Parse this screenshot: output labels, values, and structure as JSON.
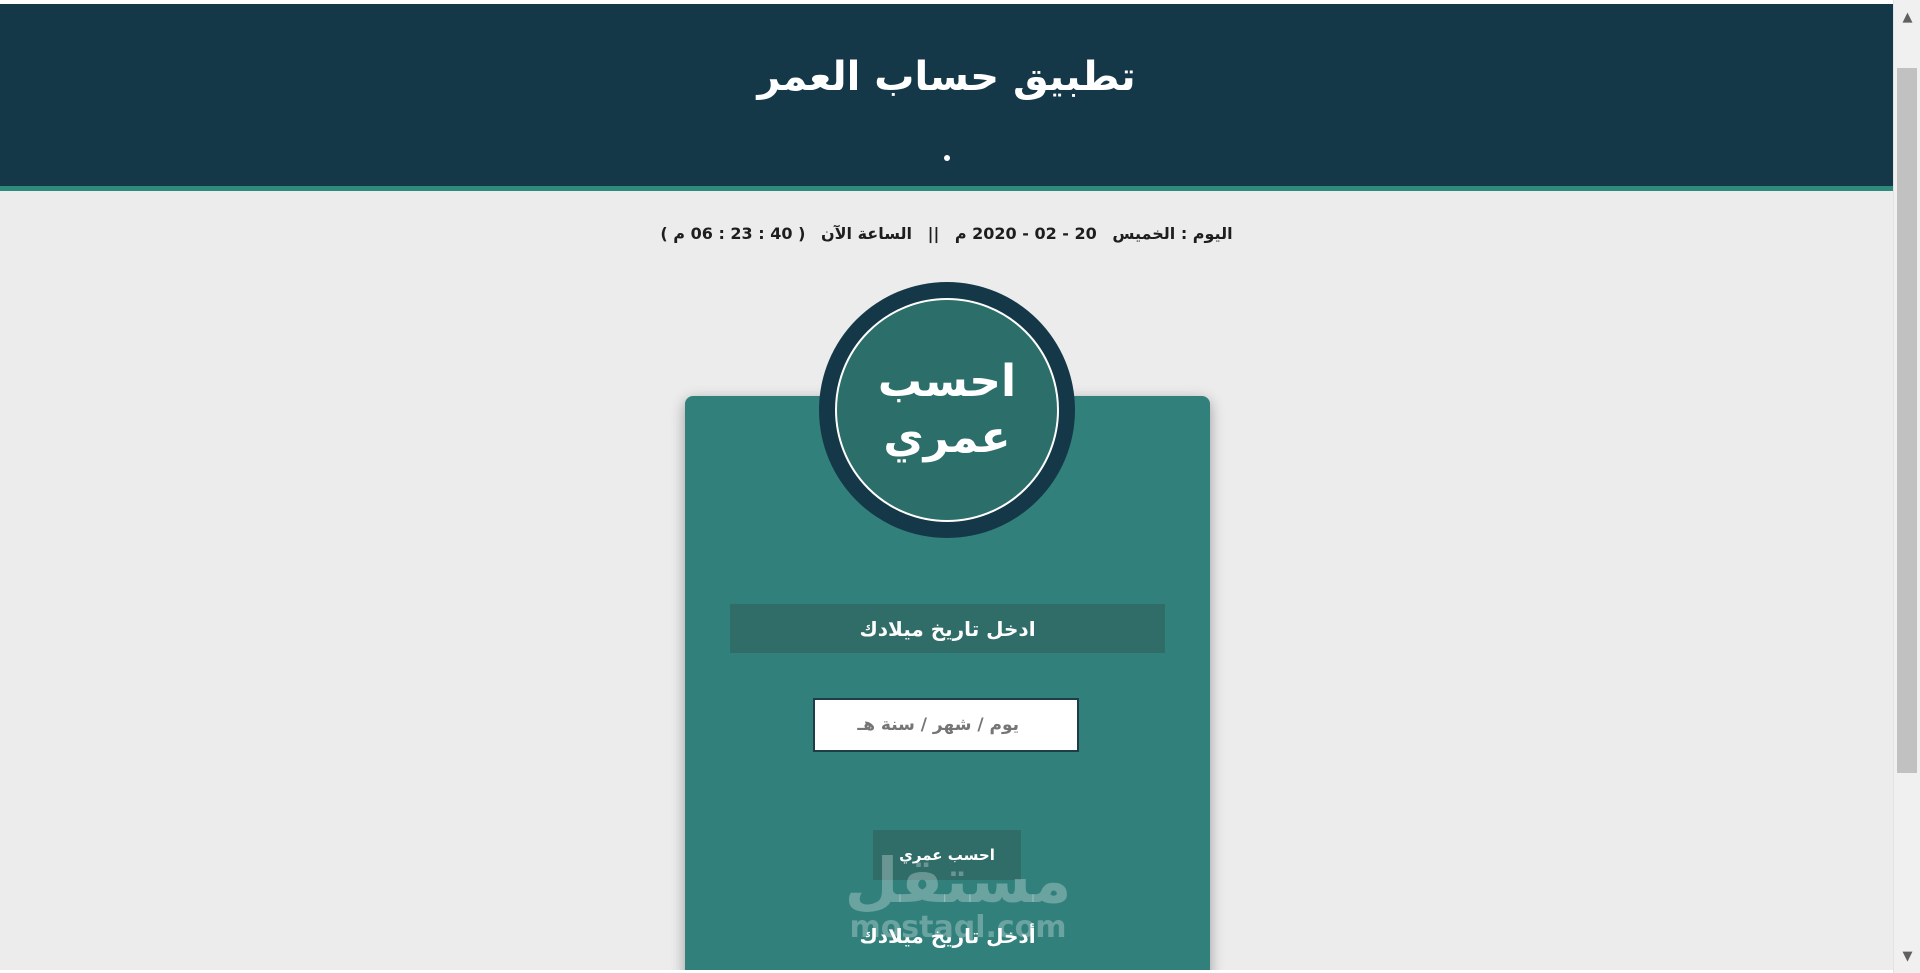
{
  "header": {
    "title": "تطبيق حساب العمر",
    "dot": "•"
  },
  "date_info": {
    "day": "اليوم : الخميس",
    "date": "20 - 02 - 2020 م",
    "separator": "||",
    "time_label": "الساعة الآن",
    "time": "( 40 : 23 : 06 م )"
  },
  "badge": {
    "line1": "احسب",
    "line2": "عمري"
  },
  "form": {
    "title": "ادخل تاريخ ميلادك",
    "date_placeholder": "يوم / شهر / سنة هـ",
    "button_label": "احسب عمري",
    "title_2": "أدخل تاريخ ميلادك"
  },
  "watermark": {
    "arabic": "مستقل",
    "latin": "mostaql.com"
  },
  "scrollbar": {
    "up": "▲",
    "down": "▼"
  },
  "colors": {
    "header_bg": "#143848",
    "accent": "#2f8a7e",
    "card_bg": "#32807c",
    "page_bg": "#ececec"
  }
}
